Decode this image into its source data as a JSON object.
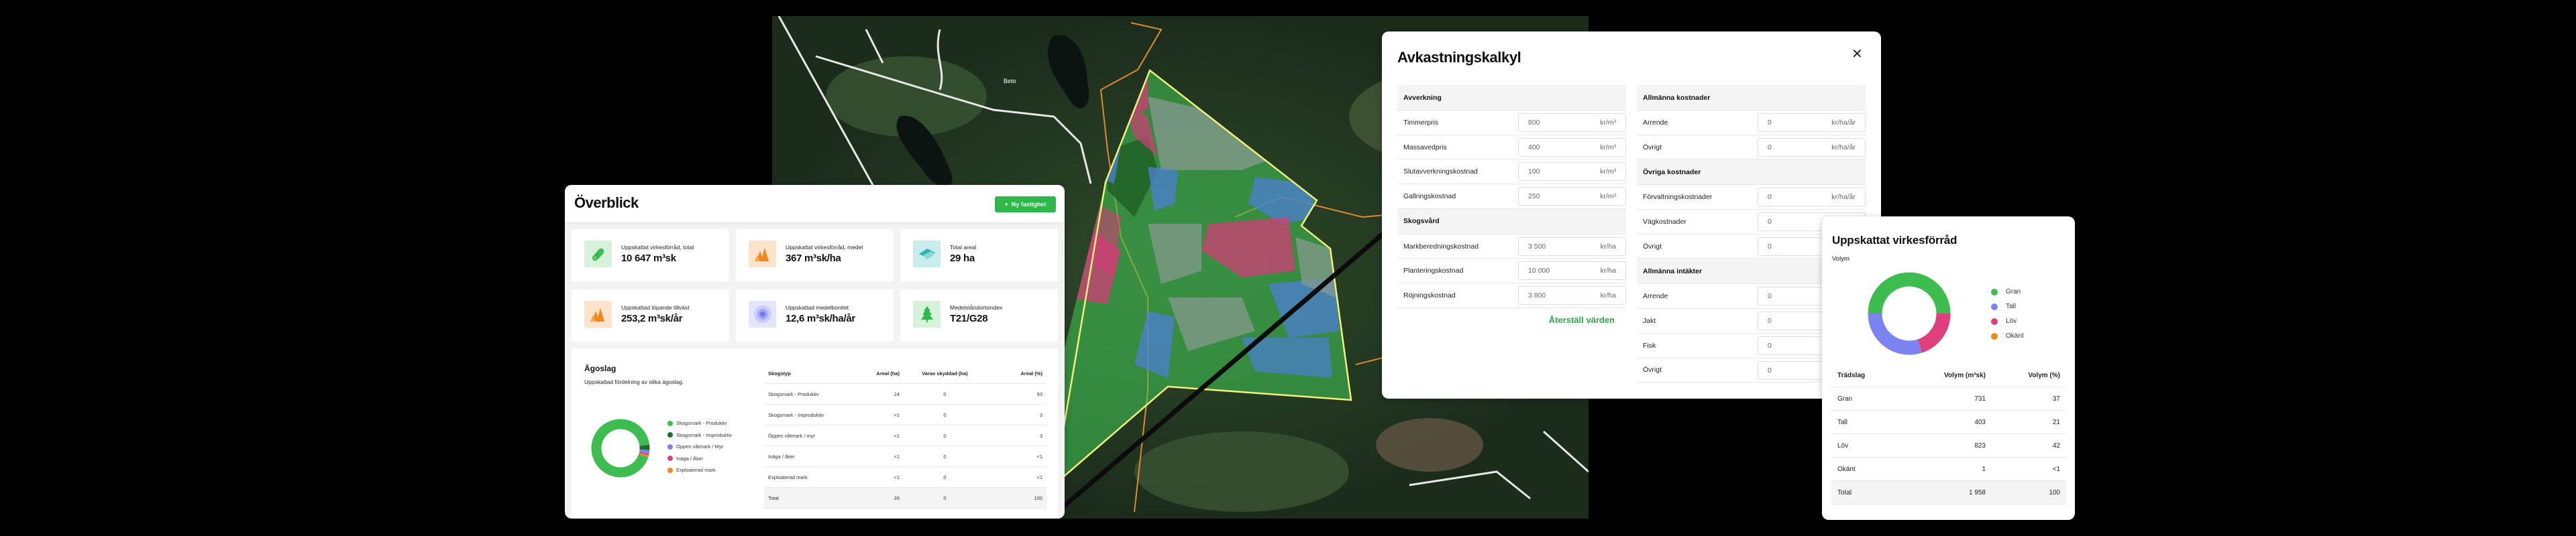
{
  "colors": {
    "accent": "#2fb84a",
    "gran": "#3dbd4f",
    "tall": "#7b83f0",
    "lov": "#df3f7c",
    "okant": "#f08a1c",
    "improduktiv": "#1f6b33",
    "polygon_edge": "#f2f27a"
  },
  "map": {
    "place_label": "Beto"
  },
  "overblick": {
    "title": "Överblick",
    "new_button": {
      "icon": "plus-icon",
      "label": "Ny fastighet"
    },
    "cards": [
      {
        "icon": "log-icon",
        "label": "Uppskattat virkesförråd, total",
        "value": "10 647 m³sk",
        "bg": "#d6f2da"
      },
      {
        "icon": "trees-icon",
        "label": "Uppskattat virkesförråd, medel",
        "value": "367 m³sk/ha",
        "bg": "#fde2cc"
      },
      {
        "icon": "area-icon",
        "label": "Total areal",
        "value": "29 ha",
        "bg": "#c9ecec"
      },
      {
        "icon": "growth-trees-icon",
        "label": "Uppskattad löpande tillväxt",
        "value": "253,2 m³sk/år",
        "bg": "#fde2cc"
      },
      {
        "icon": "target-icon",
        "label": "Uppskattad medelbonitet",
        "value": "12,6 m³sk/ha/år",
        "bg": "#e3e4fd"
      },
      {
        "icon": "spruce-icon",
        "label": "Medelståndortsindex",
        "value": "T21/G28",
        "bg": "#d6f2da"
      }
    ],
    "agoslag": {
      "title": "Ägoslag",
      "subtitle": "Uppskattad fördelning av olika ägoslag.",
      "legend": [
        {
          "label": "Skogsmark - Produktiv",
          "color": "#3dbd4f"
        },
        {
          "label": "Skogsmark - Improduktiv",
          "color": "#1f6b33"
        },
        {
          "label": "Öppen våtmark / Myr",
          "color": "#7b83f0"
        },
        {
          "label": "Inäga / Åker",
          "color": "#df3f7c"
        },
        {
          "label": "Exploaterad mark",
          "color": "#f08a1c"
        }
      ],
      "headers": [
        "Skogstyp",
        "Areal (ha)",
        "Varav skyddad (ha)",
        "Areal (%)"
      ],
      "rows": [
        [
          "Skogsmark - Produktiv",
          "24",
          "0",
          "93"
        ],
        [
          "Skogsmark - Improduktiv",
          "<1",
          "0",
          "3"
        ],
        [
          "Öppen våtmark / myr",
          "<1",
          "0",
          "3"
        ],
        [
          "Inäga / åker",
          "<1",
          "0",
          "<1"
        ],
        [
          "Exploaterad mark",
          "<1",
          "0",
          "<1"
        ]
      ],
      "total": [
        "Total",
        "26",
        "0",
        "100"
      ]
    }
  },
  "chart_data": [
    {
      "type": "pie",
      "variant": "donut",
      "categories": [
        "Skogsmark - Produktiv",
        "Skogsmark - Improduktiv",
        "Öppen våtmark / Myr",
        "Inäga / Åker",
        "Exploaterad mark"
      ],
      "values": [
        93,
        3,
        2,
        1,
        1
      ]
    },
    {
      "type": "pie",
      "variant": "donut",
      "title": "Uppskattat virkesförråd",
      "subtitle": "Volym",
      "categories": [
        "Gran",
        "Tall",
        "Löv",
        "Okänt"
      ],
      "values": [
        50,
        30,
        20,
        0
      ]
    }
  ],
  "modal": {
    "title": "Avkastningskalkyl",
    "close_icon": "close-icon",
    "left": [
      {
        "section": "Avverkning",
        "rows": [
          {
            "label": "Timmerpris",
            "value": "800",
            "unit": "kr/m³"
          },
          {
            "label": "Massavedpris",
            "value": "400",
            "unit": "kr/m³"
          },
          {
            "label": "Slutavverkningskostnad",
            "value": "100",
            "unit": "kr/m³"
          },
          {
            "label": "Gallringskostnad",
            "value": "250",
            "unit": "kr/m³"
          }
        ]
      },
      {
        "section": "Skogsvård",
        "rows": [
          {
            "label": "Markberedningskostnad",
            "value": "3 500",
            "unit": "kr/ha"
          },
          {
            "label": "Planteringskostnad",
            "value": "10 000",
            "unit": "kr/ha"
          },
          {
            "label": "Röjningskostnad",
            "value": "3 800",
            "unit": "kr/ha"
          }
        ]
      }
    ],
    "right": [
      {
        "section": "Allmänna kostnader",
        "rows": [
          {
            "label": "Arrende",
            "value": "0",
            "unit": "kr/ha/år"
          },
          {
            "label": "Övrigt",
            "value": "0",
            "unit": "kr/ha/år"
          }
        ]
      },
      {
        "section": "Övriga kostnader",
        "rows": [
          {
            "label": "Förvaltningskostnader",
            "value": "0",
            "unit": "kr/ha/år"
          },
          {
            "label": "Vägkostnader",
            "value": "0",
            "unit": ""
          },
          {
            "label": "Övrigt",
            "value": "0",
            "unit": ""
          }
        ]
      },
      {
        "section": "Allmänna intäkter",
        "rows": [
          {
            "label": "Arrende",
            "value": "0",
            "unit": ""
          },
          {
            "label": "Jakt",
            "value": "0",
            "unit": ""
          },
          {
            "label": "Fisk",
            "value": "0",
            "unit": ""
          },
          {
            "label": "Övrigt",
            "value": "0",
            "unit": ""
          }
        ]
      }
    ],
    "reset_label": "Återställ värden"
  },
  "virkes": {
    "title": "Uppskattat virkesförråd",
    "subtitle": "Volym",
    "legend": [
      {
        "label": "Gran",
        "color": "#3dbd4f"
      },
      {
        "label": "Tall",
        "color": "#7b83f0"
      },
      {
        "label": "Löv",
        "color": "#df3f7c"
      },
      {
        "label": "Okänt",
        "color": "#f08a1c"
      }
    ],
    "headers": [
      "Trädslag",
      "Volym (m³sk)",
      "Volym (%)"
    ],
    "rows": [
      [
        "Gran",
        "731",
        "37"
      ],
      [
        "Tall",
        "403",
        "21"
      ],
      [
        "Löv",
        "823",
        "42"
      ],
      [
        "Okänt",
        "1",
        "<1"
      ]
    ],
    "total": [
      "Total",
      "1 958",
      "100"
    ]
  }
}
